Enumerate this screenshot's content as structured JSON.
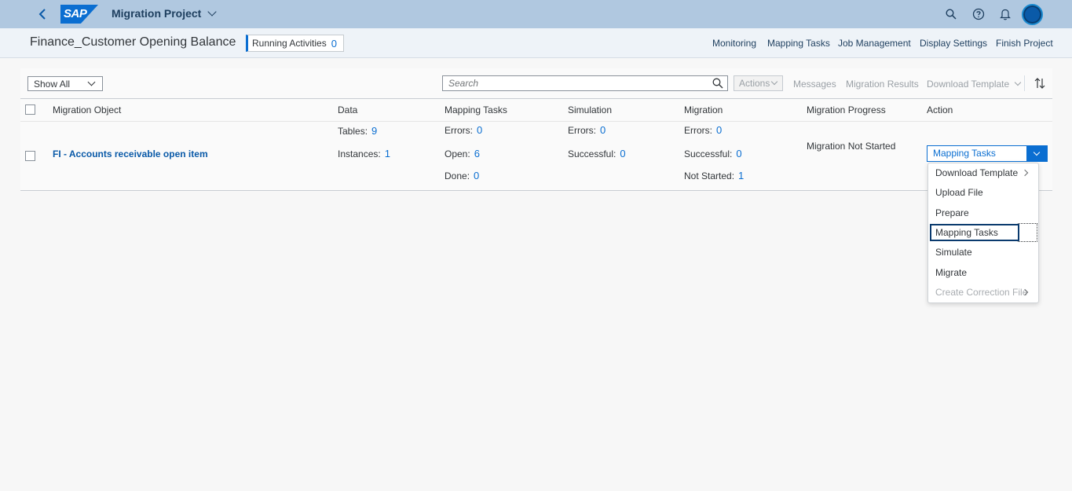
{
  "shell": {
    "app_title": "Migration Project",
    "logo_text": "SAP",
    "icons": [
      "back-icon",
      "search-icon",
      "help-icon",
      "bell-icon",
      "avatar"
    ]
  },
  "subheader": {
    "title": "Finance_Customer Opening Balance",
    "running_label": "Running Activities",
    "running_count": "0",
    "nav": [
      "Monitoring",
      "Mapping Tasks",
      "Job Management",
      "Display Settings",
      "Finish Project"
    ]
  },
  "toolbar": {
    "filter_value": "Show All",
    "search_placeholder": "Search",
    "actions_label": "Actions",
    "messages_label": "Messages",
    "migration_results_label": "Migration Results",
    "download_template_label": "Download Template"
  },
  "table": {
    "headers": [
      "Migration Object",
      "Data",
      "Mapping Tasks",
      "Simulation",
      "Migration",
      "Migration Progress",
      "Action"
    ],
    "row": {
      "object": "FI - Accounts receivable open item",
      "data": {
        "tables_label": "Tables:",
        "tables": "9",
        "instances_label": "Instances:",
        "instances": "1"
      },
      "mapping": {
        "errors_label": "Errors:",
        "errors": "0",
        "open_label": "Open:",
        "open": "6",
        "done_label": "Done:",
        "done": "0"
      },
      "simulation": {
        "errors_label": "Errors:",
        "errors": "0",
        "successful_label": "Successful:",
        "successful": "0"
      },
      "migration": {
        "errors_label": "Errors:",
        "errors": "0",
        "successful_label": "Successful:",
        "successful": "0",
        "not_started_label": "Not Started:",
        "not_started": "1"
      },
      "progress": "Migration Not Started",
      "action_label": "Mapping Tasks"
    }
  },
  "menu": {
    "items": [
      "Download Template",
      "Upload File",
      "Prepare",
      "Mapping Tasks",
      "Simulate",
      "Migrate",
      "Create Correction File"
    ]
  },
  "colors": {
    "shell_bg": "#b0c8e0",
    "accent": "#0a6ed1",
    "link": "#0a5aa8"
  }
}
